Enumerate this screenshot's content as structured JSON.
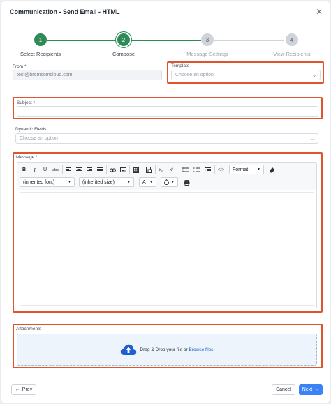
{
  "modal": {
    "title": "Communication - Send Email - HTML",
    "close_icon": "✕"
  },
  "stepper": {
    "active_color": "#2e8b57",
    "inactive_color": "#d0d4da",
    "steps": [
      {
        "number": "1",
        "label": "Select Recipients",
        "state": "completed"
      },
      {
        "number": "2",
        "label": "Compose",
        "state": "active"
      },
      {
        "number": "3",
        "label": "Message Settings",
        "state": "pending"
      },
      {
        "number": "4",
        "label": "View Recipients",
        "state": "pending"
      }
    ]
  },
  "form": {
    "from_label": "From *",
    "from_value": "test@bromcomcloud.com",
    "template_label": "Template",
    "template_placeholder": "Choose an option",
    "subject_label": "Subject *",
    "subject_value": "",
    "dynamic_fields_label": "Dynamic Fields",
    "dynamic_fields_placeholder": "Choose an option",
    "message_label": "Message *",
    "attachments_label": "Attachments",
    "highlight_color": "#e0542d"
  },
  "toolbar": {
    "bold": "B",
    "italic": "I",
    "underline": "U",
    "strike": "abc",
    "subscript": "x₂",
    "superscript": "x²",
    "source": "</>",
    "format_label": "Format",
    "font_label": "(inherited font)",
    "size_label": "(inherited size)",
    "text_color_label": "A"
  },
  "dropzone": {
    "text": "Drag & Drop your file or",
    "browse_label": "Browse files",
    "accent_color": "#1d5fd1"
  },
  "footer": {
    "prev_label": "Prev",
    "cancel_label": "Cancel",
    "next_label": "Next",
    "primary_color": "#3b82f6"
  }
}
